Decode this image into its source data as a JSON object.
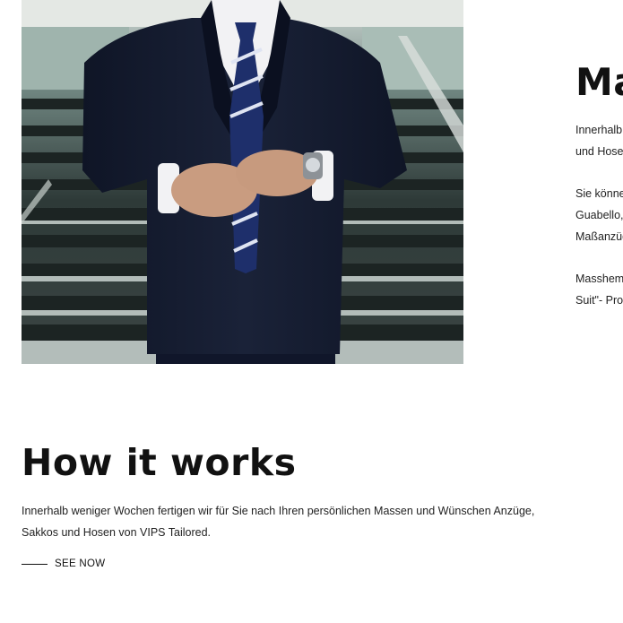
{
  "right_column": {
    "title": "Ma",
    "paragraph1": [
      "Innerhalb",
      "und Hosen"
    ],
    "paragraph2": [
      "Sie könne",
      "Guabello,",
      "Maßanzüg"
    ],
    "paragraph3": [
      "Masshem",
      "Suit\"- Prog"
    ]
  },
  "how_it_works": {
    "title": "How it works",
    "text": "Innerhalb weniger Wochen fertigen wir für Sie nach Ihren persönlichen Massen und Wünschen Anzüge, Sakkos und Hosen von VIPS Tailored.",
    "link_label": "SEE NOW"
  },
  "colors": {
    "suit": "#141b2e",
    "tie_blue": "#1e2f6b",
    "shirt": "#f2f2f4",
    "skin": "#c99c80",
    "background_stairs": "#2f3a38"
  }
}
